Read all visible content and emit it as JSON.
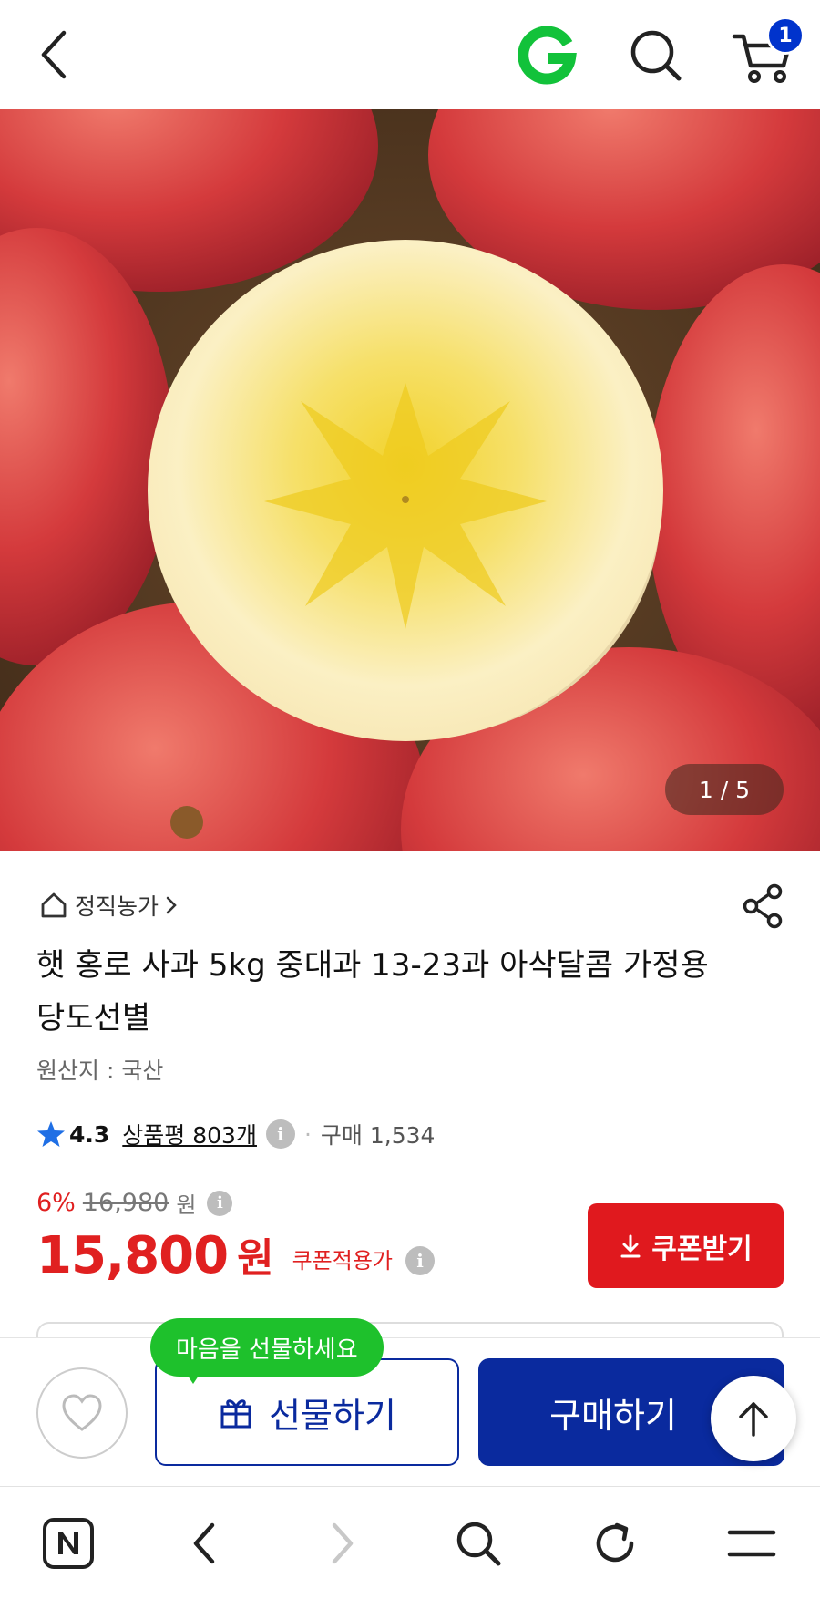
{
  "header": {
    "cart_count": "1",
    "brand_icon": "g-logo-icon",
    "accent_green": "#12c23a"
  },
  "gallery": {
    "counter": "1 / 5"
  },
  "product": {
    "seller": "정직농가",
    "title": "햇 홍로 사과 5kg 중대과 13-23과 아삭달콤 가정용 당도선별",
    "origin": "원산지 : 국산",
    "rating": "4.3",
    "review_label": "상품평 803개",
    "buy_count": "구매 1,534"
  },
  "price": {
    "discount": "6%",
    "original": "16,980",
    "original_unit": "원",
    "final": "15,800",
    "final_unit": "원",
    "coupon_price_label": "쿠폰적용가",
    "coupon_button": "쿠폰받기",
    "accent_red": "#e0191e"
  },
  "actions": {
    "gift_tooltip": "마음을 선물하세요",
    "gift_label": "선물하기",
    "buy_label": "구매하기",
    "accent_blue": "#0a2a9e"
  },
  "browser_nav": {
    "icons": [
      "naver-n-icon",
      "back-icon",
      "forward-icon",
      "search-icon",
      "refresh-icon",
      "menu-icon"
    ]
  }
}
